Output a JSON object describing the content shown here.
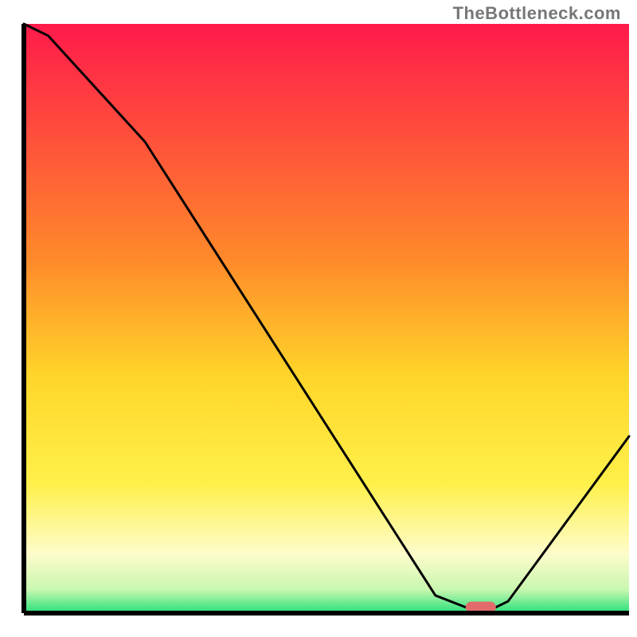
{
  "watermark": "TheBottleneck.com",
  "chart_data": {
    "type": "line",
    "title": "",
    "xlabel": "",
    "ylabel": "",
    "xlim": [
      0,
      100
    ],
    "ylim": [
      0,
      100
    ],
    "x": [
      0,
      4,
      20,
      68,
      73,
      78,
      80,
      100
    ],
    "values": [
      100,
      98,
      80,
      3,
      1,
      1,
      2,
      30
    ],
    "marker": {
      "x_start": 73,
      "x_end": 78,
      "y": 1
    },
    "gradient_stops": [
      {
        "offset": 0,
        "color": "#ff1a4b"
      },
      {
        "offset": 40,
        "color": "#ff8a2a"
      },
      {
        "offset": 60,
        "color": "#ffd62a"
      },
      {
        "offset": 78,
        "color": "#fff04a"
      },
      {
        "offset": 90,
        "color": "#fdfccb"
      },
      {
        "offset": 96,
        "color": "#c9f7b0"
      },
      {
        "offset": 100,
        "color": "#26e07a"
      }
    ],
    "axis_color": "#000000",
    "line_color": "#000000",
    "marker_color": "#e26a6a"
  }
}
